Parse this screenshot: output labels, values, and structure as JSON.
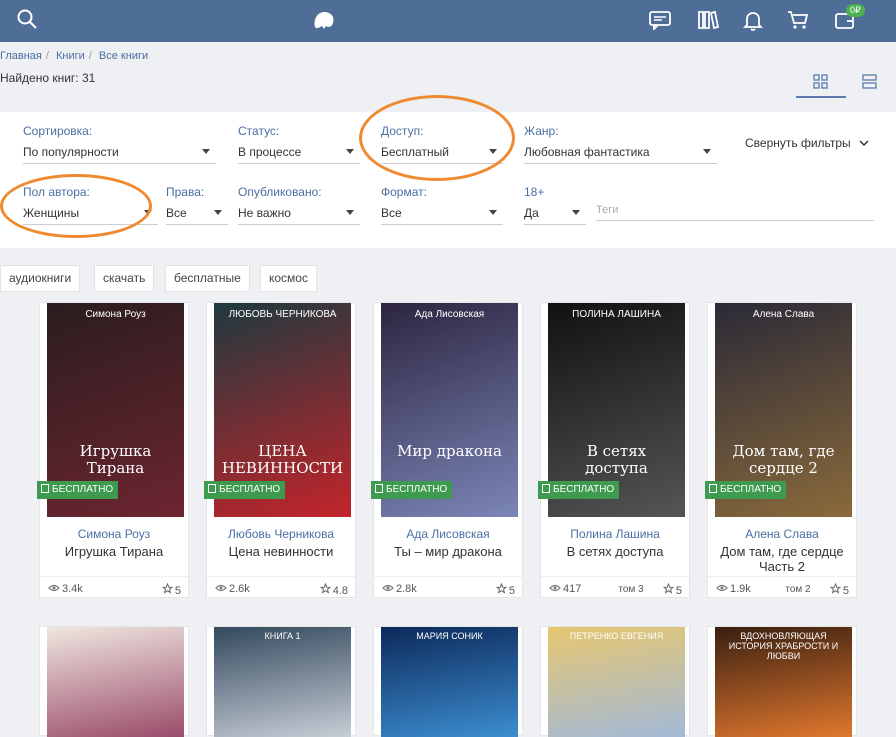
{
  "breadcrumb": [
    "Главная",
    "Книги",
    "Все книги"
  ],
  "found": "Найдено книг: 31",
  "cart_badge": "0₽",
  "filters": [
    {
      "label": "Сортировка:",
      "value": "По популярности"
    },
    {
      "label": "Статус:",
      "value": "В процессе"
    },
    {
      "label": "Доступ:",
      "value": "Бесплатный"
    },
    {
      "label": "Жанр:",
      "value": "Любовная фантастика"
    },
    {
      "label": "Пол автора:",
      "value": "Женщины"
    },
    {
      "label": "Права:",
      "value": "Все"
    },
    {
      "label": "Опубликовано:",
      "value": "Не важно"
    },
    {
      "label": "Формат:",
      "value": "Все"
    },
    {
      "label": "18+",
      "value": "Да"
    }
  ],
  "tags_placeholder": "Теги",
  "collapse_filters": "Свернуть фильтры",
  "tags": [
    "аудиокниги",
    "скачать",
    "бесплатные",
    "космос"
  ],
  "free_badge": "БЕСПЛАТНО",
  "books": [
    {
      "author": "Симона Роуз",
      "title": "Игрушка Тирана",
      "views": "3.4k",
      "tom": "",
      "rating": "5",
      "cover_text": "Игрушка Тирана",
      "cover_author": "Симона Роуз",
      "colors": [
        "#2a1d1f",
        "#6d2530"
      ]
    },
    {
      "author": "Любовь Черникова",
      "title": "Цена невинности",
      "views": "2.6k",
      "tom": "",
      "rating": "4.8",
      "cover_text": "ЦЕНА НЕВИННОСТИ",
      "cover_author": "ЛЮБОВЬ ЧЕРНИКОВА",
      "colors": [
        "#1e3a3f",
        "#c4242a"
      ]
    },
    {
      "author": "Ада Лисовская",
      "title": "Ты – мир дракона",
      "views": "2.8k",
      "tom": "",
      "rating": "5",
      "cover_text": "Мир дракона",
      "cover_author": "Ада Лисовская",
      "colors": [
        "#2d2540",
        "#7b86b8"
      ]
    },
    {
      "author": "Полина Лашина",
      "title": "В сетях доступа",
      "views": "417",
      "tom": "том 3",
      "rating": "5",
      "cover_text": "В сетях доступа",
      "cover_author": "ПОЛИНА ЛАШИНА",
      "colors": [
        "#111",
        "#555"
      ]
    },
    {
      "author": "Алена Слава",
      "title": "Дом там, где сердце Часть 2",
      "views": "1.9k",
      "tom": "том 2",
      "rating": "5",
      "cover_text": "Дом там, где сердце 2",
      "cover_author": "Алена Слава",
      "colors": [
        "#2b2a38",
        "#8a6a3a"
      ]
    }
  ],
  "row2": [
    {
      "colors": [
        "#efe6e0",
        "#9a4c6a"
      ],
      "cover_text": ""
    },
    {
      "colors": [
        "#34495e",
        "#c7cdd6"
      ],
      "cover_text": "КНИГА 1"
    },
    {
      "colors": [
        "#0c2a5a",
        "#3c8dd0"
      ],
      "cover_text": "МАРИЯ СОНИК"
    },
    {
      "colors": [
        "#e6c770",
        "#a3b9d8"
      ],
      "cover_text": "ПЕТРЕНКО ЕВГЕНИЯ"
    },
    {
      "colors": [
        "#3a1f10",
        "#e0782e"
      ],
      "cover_text": "ВДОХНОВЛЯЮЩАЯ ИСТОРИЯ ХРАБРОСТИ И ЛЮБВИ"
    }
  ]
}
